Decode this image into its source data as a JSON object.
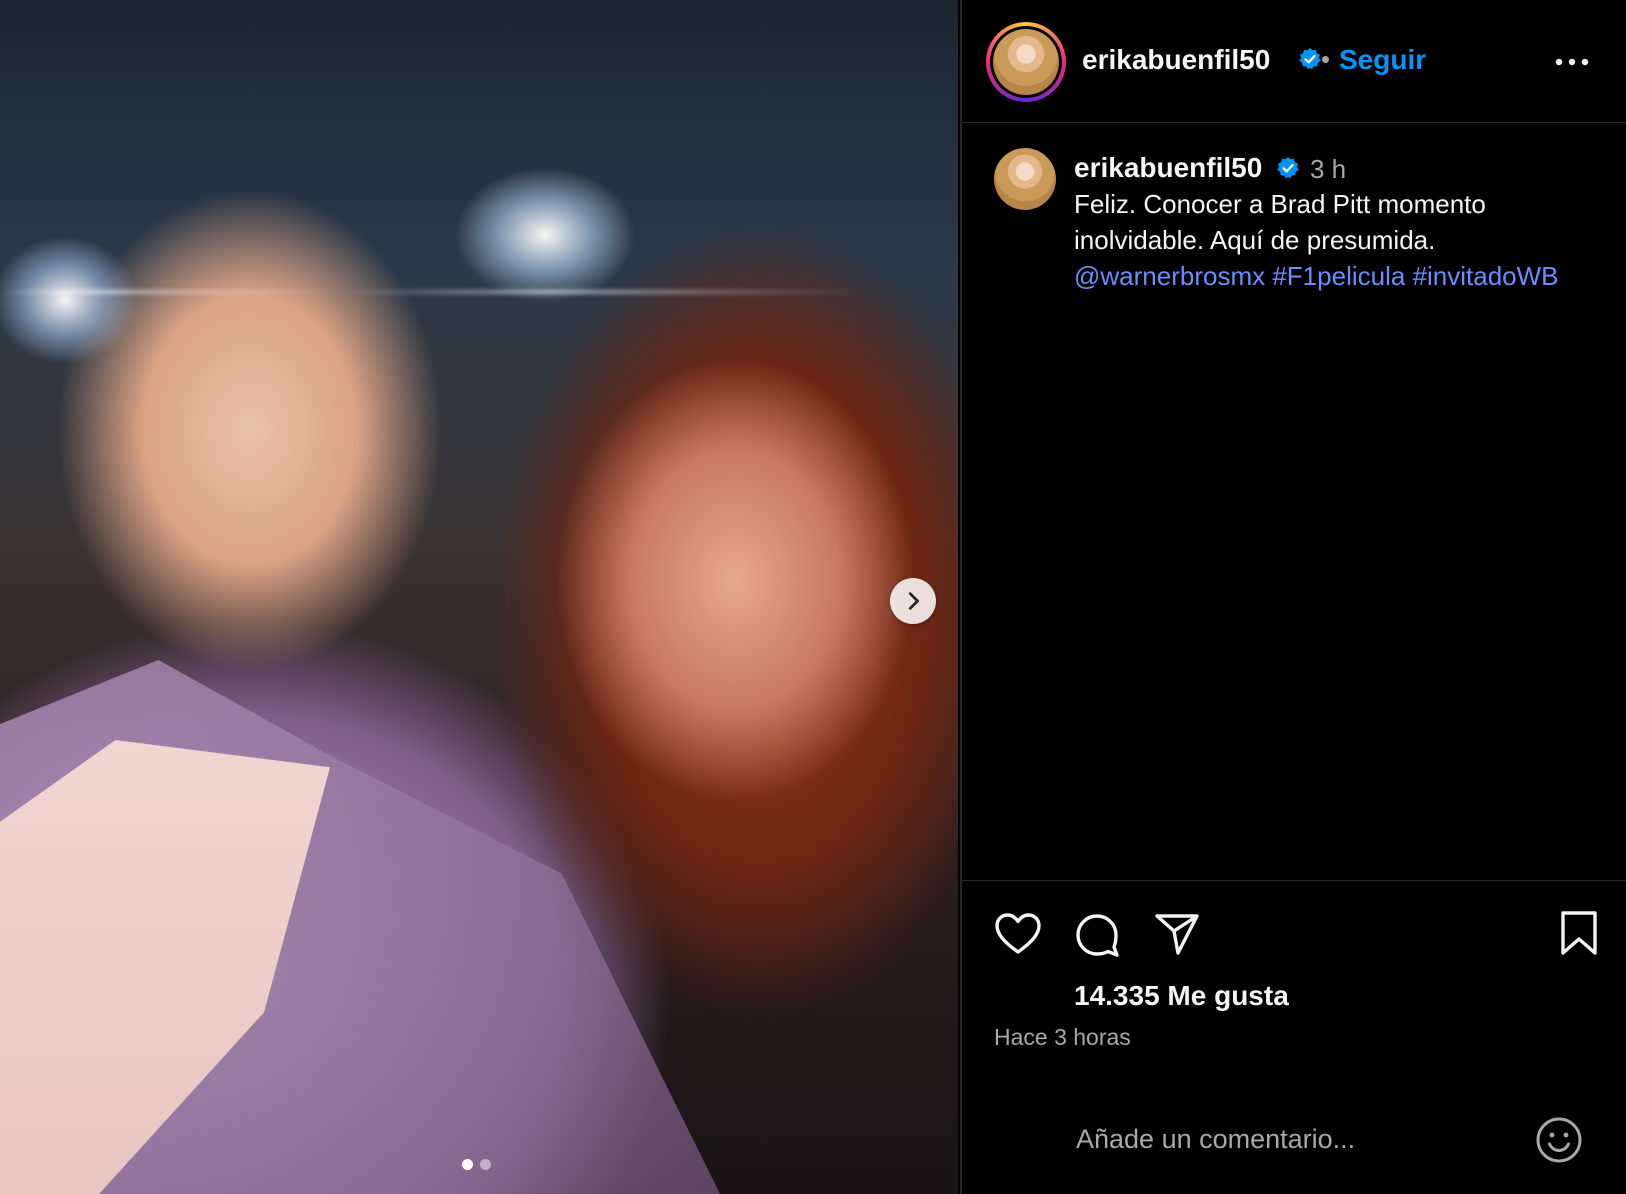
{
  "media": {
    "alt_label": "",
    "slides_total": 2,
    "slide_active": 1
  },
  "post": {
    "username": "erikabuenfil50",
    "follow_label": "Seguir",
    "separator": "•",
    "time_short": "3 h",
    "caption_text_1": "Feliz. Conocer a Brad Pitt momento inolvidable. Aquí de presumida.",
    "mention": "@warnerbrosmx",
    "hashtag_1": "#F1pelicula",
    "hashtag_2": "#invitadoWB",
    "likes": "14.335 Me gusta",
    "time_ago": "Hace 3 horas",
    "comment_placeholder": "Añade un comentario..."
  },
  "colors": {
    "accent": "#0095f6",
    "link": "#6c8dff",
    "verified": "#0095f6",
    "background": "#000000",
    "text_secondary": "#a8a8a8"
  },
  "icons": [
    "chevron-right-icon",
    "verified-badge-icon",
    "more-options-icon",
    "heart-icon",
    "comment-icon",
    "share-icon",
    "bookmark-icon",
    "emoji-icon"
  ]
}
